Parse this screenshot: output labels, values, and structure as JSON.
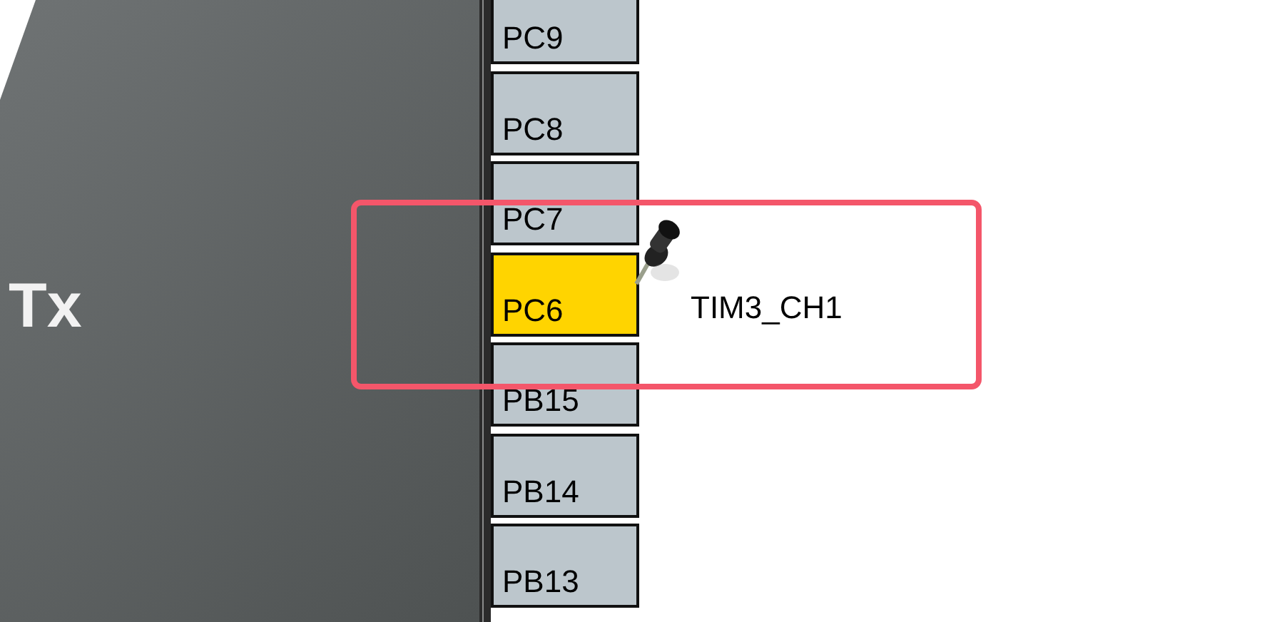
{
  "chip": {
    "label": "Tx"
  },
  "pins": [
    {
      "name": "PC9",
      "selected": false
    },
    {
      "name": "PC8",
      "selected": false
    },
    {
      "name": "PC7",
      "selected": false
    },
    {
      "name": "PC6",
      "selected": true,
      "pinned": true,
      "signal": "TIM3_CH1"
    },
    {
      "name": "PB15",
      "selected": false
    },
    {
      "name": "PB14",
      "selected": false
    },
    {
      "name": "PB13",
      "selected": false
    }
  ],
  "annotation": {
    "kind": "highlight-box"
  }
}
